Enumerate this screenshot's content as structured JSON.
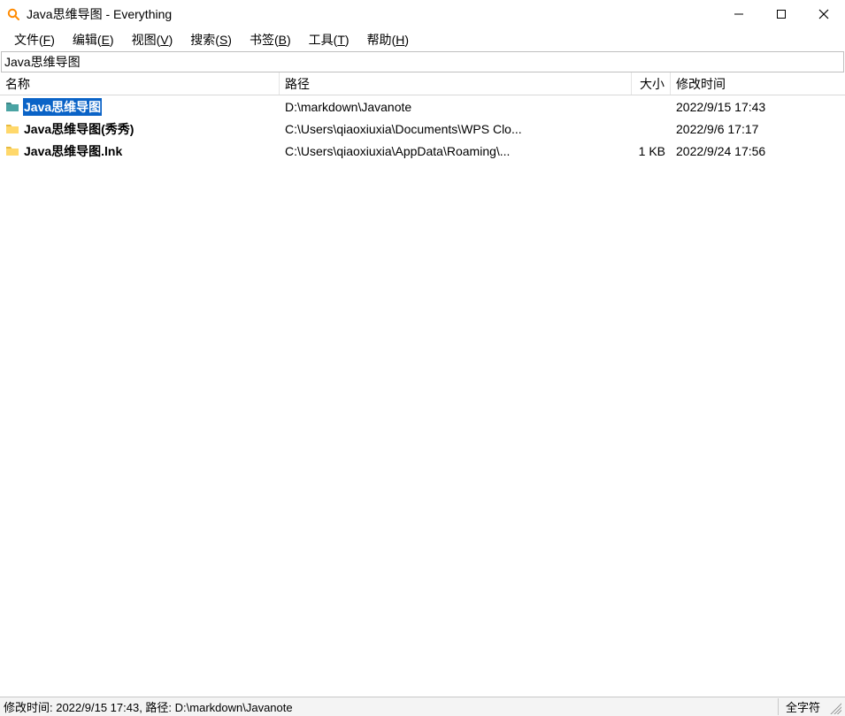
{
  "window": {
    "title": "Java思维导图 - Everything"
  },
  "menu": {
    "file": {
      "label": "文件",
      "accel": "F"
    },
    "edit": {
      "label": "编辑",
      "accel": "E"
    },
    "view": {
      "label": "视图",
      "accel": "V"
    },
    "search": {
      "label": "搜索",
      "accel": "S"
    },
    "bookmark": {
      "label": "书签",
      "accel": "B"
    },
    "tools": {
      "label": "工具",
      "accel": "T"
    },
    "help": {
      "label": "帮助",
      "accel": "H"
    }
  },
  "search": {
    "value": "Java思维导图"
  },
  "columns": {
    "name": "名称",
    "path": "路径",
    "size": "大小",
    "date": "修改时间"
  },
  "results": [
    {
      "name": "Java思维导图",
      "icon": "folder-teal",
      "path": "D:\\markdown\\Javanote",
      "size": "",
      "date": "2022/9/15 17:43",
      "selected": true
    },
    {
      "name": "Java思维导图(秀秀)",
      "icon": "folder-yellow",
      "path": "C:\\Users\\qiaoxiuxia\\Documents\\WPS Clo...",
      "size": "",
      "date": "2022/9/6 17:17",
      "selected": false
    },
    {
      "name": "Java思维导图.lnk",
      "icon": "folder-yellow",
      "path": "C:\\Users\\qiaoxiuxia\\AppData\\Roaming\\...",
      "size": "1 KB",
      "date": "2022/9/24 17:56",
      "selected": false
    }
  ],
  "status": {
    "left": "修改时间: 2022/9/15 17:43, 路径: D:\\markdown\\Javanote",
    "right": "全字符"
  }
}
